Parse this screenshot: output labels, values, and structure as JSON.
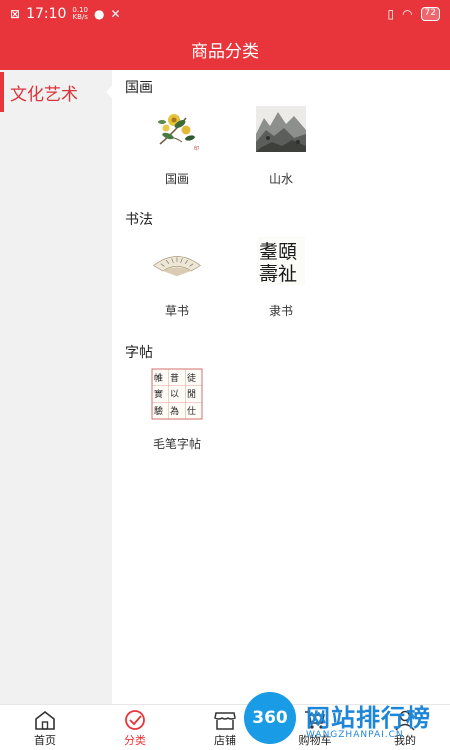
{
  "status": {
    "time": "17:10",
    "net_top": "0.10",
    "net_bottom": "KB/s",
    "battery": "72"
  },
  "header": {
    "title": "商品分类"
  },
  "sidebar": {
    "items": [
      {
        "label": "文化艺术"
      }
    ]
  },
  "sections": [
    {
      "title": "国画",
      "items": [
        {
          "label": "国画",
          "thumb": "flower-painting"
        },
        {
          "label": "山水",
          "thumb": "landscape-painting"
        }
      ]
    },
    {
      "title": "书法",
      "items": [
        {
          "label": "草书",
          "thumb": "fan-calligraphy"
        },
        {
          "label": "隶书",
          "thumb": "seal-calligraphy",
          "text": "耋頤 壽祉"
        }
      ]
    },
    {
      "title": "字帖",
      "items": [
        {
          "label": "毛笔字帖",
          "thumb": "copybook",
          "text": "徒閒 竹仕 昔以 祥為 帷實 求驗"
        }
      ]
    }
  ],
  "tabbar": {
    "items": [
      {
        "label": "首页",
        "icon": "home-icon"
      },
      {
        "label": "分类",
        "icon": "category-icon",
        "active": true
      },
      {
        "label": "店铺",
        "icon": "shop-icon"
      },
      {
        "label": "购物车",
        "icon": "cart-icon"
      },
      {
        "label": "我的",
        "icon": "user-icon"
      }
    ]
  },
  "watermark": {
    "circle": "360",
    "text": "网站排行榜",
    "sub": "WANGZHANPAI.CN"
  },
  "colors": {
    "accent": "#e8353b",
    "sidebar_bg": "#f1f1f1",
    "watermark": "#1e86d8"
  }
}
